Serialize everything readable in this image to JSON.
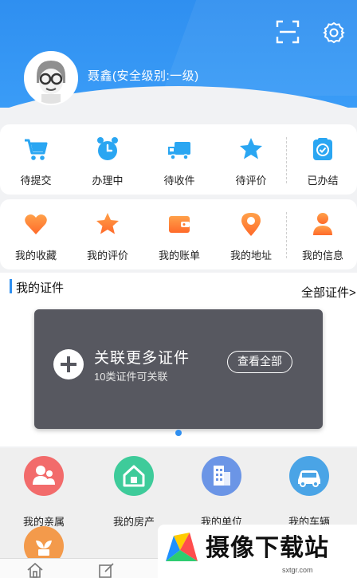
{
  "user": {
    "name": "聂鑫(安全级别:一级)"
  },
  "colors": {
    "brand_blue": "#2f8ff0",
    "card_dark": "#575860",
    "accent_orange": "#ff7a2e"
  },
  "orders": [
    {
      "label": "待提交",
      "icon": "shopping-cart-icon"
    },
    {
      "label": "办理中",
      "icon": "alarm-clock-icon"
    },
    {
      "label": "待收件",
      "icon": "delivery-truck-icon"
    },
    {
      "label": "待评价",
      "icon": "star-icon"
    },
    {
      "label": "已办结",
      "icon": "checked-box-icon"
    }
  ],
  "personal": [
    {
      "label": "我的收藏",
      "icon": "heart-icon"
    },
    {
      "label": "我的评价",
      "icon": "star-icon"
    },
    {
      "label": "我的账单",
      "icon": "wallet-icon"
    },
    {
      "label": "我的地址",
      "icon": "location-pin-icon"
    },
    {
      "label": "我的信息",
      "icon": "user-icon"
    }
  ],
  "certificates": {
    "title": "我的证件",
    "all_label": "全部证件>",
    "link_title": "关联更多证件",
    "link_subtitle": "10类证件可关联",
    "view_all_label": "查看全部"
  },
  "related": [
    {
      "label": "我的亲属",
      "icon": "family-icon",
      "color": "#f26b6b"
    },
    {
      "label": "我的房产",
      "icon": "house-icon",
      "color": "#3ecb9a"
    },
    {
      "label": "我的单位",
      "icon": "building-icon",
      "color": "#6b95e6"
    },
    {
      "label": "我的车辆",
      "icon": "car-icon",
      "color": "#4aa4e6"
    },
    {
      "label": "",
      "icon": "plant-icon",
      "color": "#f39a4b"
    }
  ],
  "tabbar": [
    {
      "icon": "home-icon"
    },
    {
      "icon": "edit-icon"
    }
  ],
  "watermark": {
    "text": "摄像下载站",
    "url": "sxtgr.com"
  }
}
